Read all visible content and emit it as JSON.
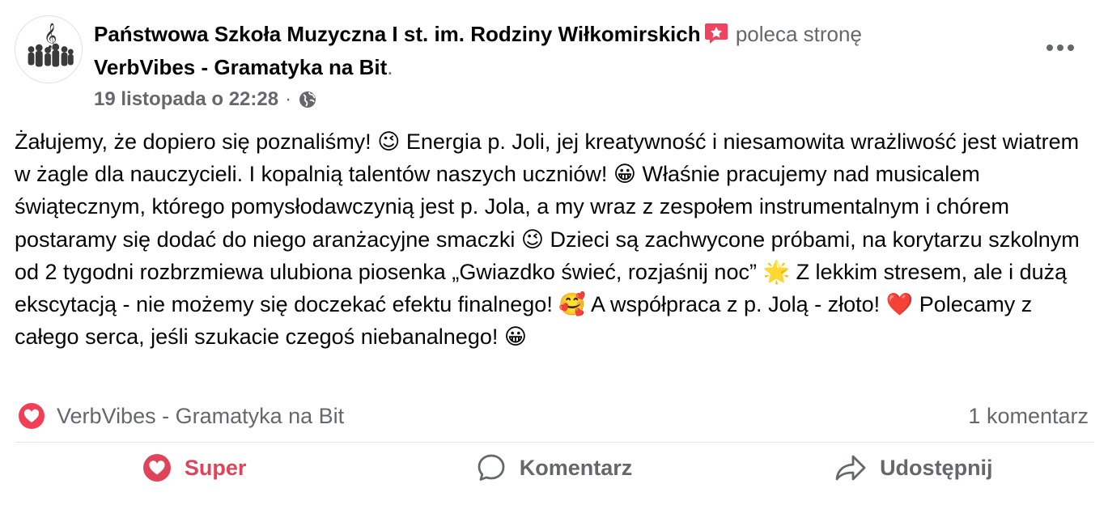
{
  "post": {
    "author": "Państwowa Szkoła Muzyczna I st. im. Rodziny Wiłkomirskich",
    "action": " poleca stronę",
    "target": "VerbVibes - Gramatyka na Bit",
    "target_suffix": ".",
    "timestamp": "19 listopada o 22:28",
    "separator": "·",
    "body": "Żałujemy, że dopiero się poznaliśmy! 😉 Energia p. Joli, jej kreatywność i niesamowita wrażliwość jest wiatrem w żagle dla nauczycieli. I kopalnią talentów naszych uczniów! 😀 Właśnie pracujemy nad musicalem świątecznym, którego pomysłodawczynią jest p. Jola, a my wraz z zespołem instrumentalnym i chórem postaramy się dodać do niego aranżacyjne smaczki 😉 Dzieci są zachwycone próbami, na korytarzu szkolnym od 2 tygodni rozbrzmiewa ulubiona piosenka „Gwiazdko świeć, rozjaśnij noc” 🌟 Z lekkim stresem, ale i dużą ekscytacją - nie możemy się doczekać efektu finalnego! 🥰 A współpraca z p. Jolą - złoto! ❤️ Polecamy z całego serca, jeśli szukacie czegoś niebanalnego! 😀"
  },
  "footer": {
    "reaction_label": "VerbVibes - Gramatyka na Bit",
    "comments": "1 komentarz"
  },
  "actions": {
    "super": "Super",
    "comment": "Komentarz",
    "share": "Udostępnij"
  },
  "icons": {
    "avatar": "school-logo-icon",
    "recommend": "recommend-star-icon",
    "privacy": "globe-icon",
    "more": "more-dots-icon",
    "reaction": "heart-reaction-icon",
    "comment": "comment-bubble-icon",
    "share": "share-arrow-icon"
  },
  "colors": {
    "super": "#e0445a",
    "muted": "#65676b",
    "text": "#050505",
    "recommend": "#f3425f"
  }
}
